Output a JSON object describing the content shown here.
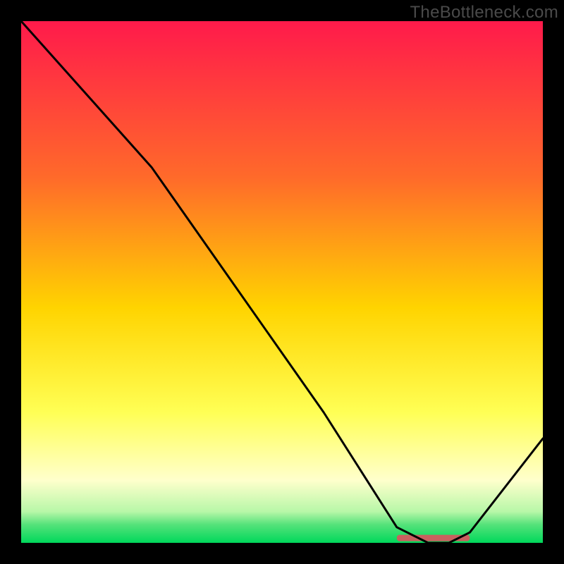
{
  "watermark": "TheBottleneck.com",
  "colors": {
    "frame": "#000000",
    "top": "#ff1a4b",
    "mid_upper": "#ff8a2a",
    "mid": "#ffd400",
    "mid_lower": "#ffff66",
    "pale": "#ffffcc",
    "green_light": "#8cf08c",
    "green": "#00d85b",
    "curve": "#000000",
    "ridge": "#c9605f"
  },
  "chart_data": {
    "type": "line",
    "title": "",
    "xlabel": "",
    "ylabel": "",
    "xlim": [
      0,
      100
    ],
    "ylim": [
      0,
      100
    ],
    "series": [
      {
        "name": "curve",
        "x": [
          0,
          25,
          58,
          72,
          78,
          82,
          86,
          100
        ],
        "values": [
          100,
          72,
          25,
          3,
          0,
          0,
          2,
          20
        ]
      }
    ],
    "ridge": {
      "x_start": 72,
      "x_end": 86,
      "y": 1
    },
    "gradient_stops": [
      {
        "pos": 0.0,
        "color": "#ff1a4b"
      },
      {
        "pos": 0.3,
        "color": "#ff6a2a"
      },
      {
        "pos": 0.55,
        "color": "#ffd400"
      },
      {
        "pos": 0.75,
        "color": "#ffff55"
      },
      {
        "pos": 0.88,
        "color": "#ffffcc"
      },
      {
        "pos": 0.94,
        "color": "#b8f7a8"
      },
      {
        "pos": 0.965,
        "color": "#55e27a"
      },
      {
        "pos": 1.0,
        "color": "#00d85b"
      }
    ]
  }
}
